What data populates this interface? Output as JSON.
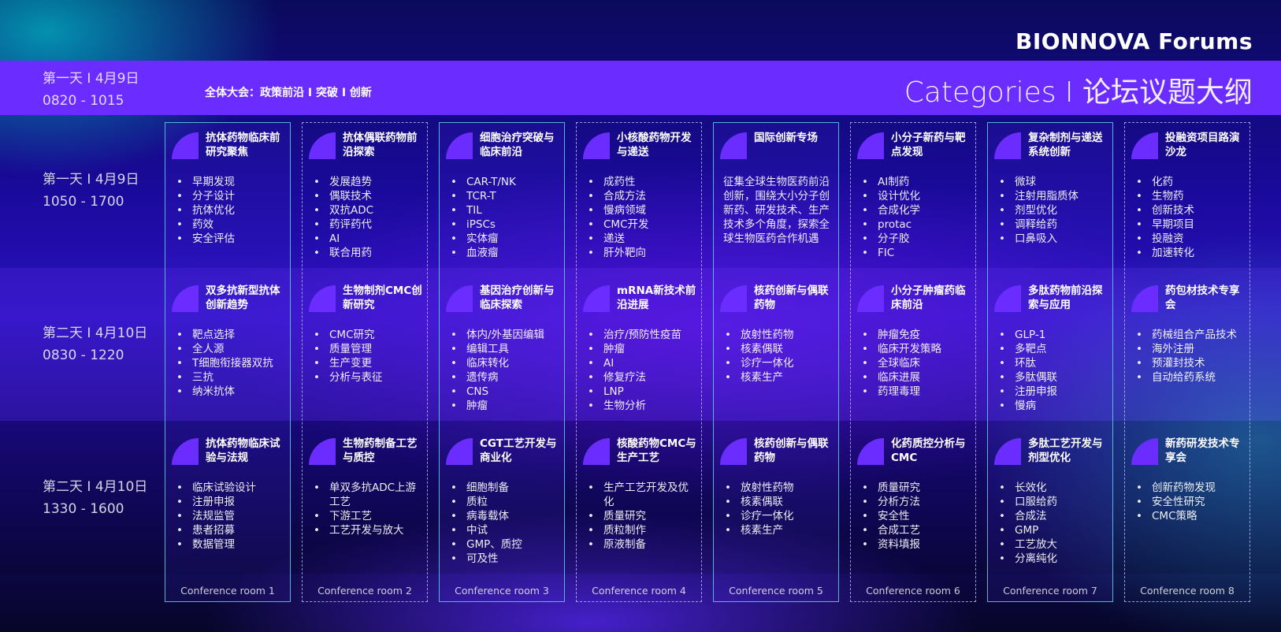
{
  "brand": "BIONNOVA Forums",
  "header": {
    "day_line": "第一天 I 4月9日",
    "time_line": "0820 - 1015",
    "plenary": "全体大会：政策前沿 I 突破 I 创新",
    "categories": "Categories   I   论坛议题大纲"
  },
  "rows": [
    {
      "day": "第一天 I 4月9日",
      "time": "1050 - 1700"
    },
    {
      "day": "第二天 I 4月10日",
      "time": "0830 - 1220"
    },
    {
      "day": "第二天 I 4月10日",
      "time": "1330 - 1600"
    }
  ],
  "columns": [
    {
      "room": "Conference room 1",
      "cells": [
        {
          "title": "抗体药物临床前研究聚焦",
          "items": [
            "早期发现",
            "分子设计",
            "抗体优化",
            "药效",
            "安全评估"
          ]
        },
        {
          "title": "双多抗新型抗体创新趋势",
          "items": [
            "靶点选择",
            "全人源",
            "T细胞衔接器双抗",
            "三抗",
            "纳米抗体"
          ]
        },
        {
          "title": "抗体药物临床试验与法规",
          "items": [
            "临床试验设计",
            "注册申报",
            "法规监管",
            "患者招募",
            "数据管理"
          ]
        }
      ]
    },
    {
      "room": "Conference room 2",
      "cells": [
        {
          "title": "抗体偶联药物前沿探索",
          "items": [
            "发展趋势",
            "偶联技术",
            "双抗ADC",
            "药评药代",
            "AI",
            "联合用药"
          ]
        },
        {
          "title": "生物制剂CMC创新研究",
          "items": [
            "CMC研究",
            "质量管理",
            "生产变更",
            "分析与表征"
          ]
        },
        {
          "title": "生物药制备工艺与质控",
          "items": [
            "单双多抗ADC上游工艺",
            "下游工艺",
            "工艺开发与放大"
          ]
        }
      ]
    },
    {
      "room": "Conference room 3",
      "cells": [
        {
          "title": "细胞治疗突破与临床前沿",
          "items": [
            "CAR-T/NK",
            "TCR-T",
            "TIL",
            "iPSCs",
            "实体瘤",
            "血液瘤"
          ]
        },
        {
          "title": "基因治疗创新与临床探索",
          "items": [
            "体内/外基因编辑",
            "编辑工具",
            "临床转化",
            "遗传病",
            "CNS",
            "肿瘤"
          ]
        },
        {
          "title": "CGT工艺开发与商业化",
          "items": [
            "细胞制备",
            "质粒",
            "病毒载体",
            "中试",
            "GMP、质控",
            "可及性"
          ]
        }
      ]
    },
    {
      "room": "Conference room 4",
      "cells": [
        {
          "title": "小核酸药物开发与递送",
          "items": [
            "成药性",
            "合成方法",
            "慢病领域",
            "CMC开发",
            "递送",
            "肝外靶向"
          ]
        },
        {
          "title": "mRNA新技术前沿进展",
          "items": [
            "治疗/预防性疫苗",
            "肿瘤",
            "AI",
            "修复疗法",
            "LNP",
            "生物分析"
          ]
        },
        {
          "title": "核酸药物CMC与生产工艺",
          "items": [
            "生产工艺开发及优化",
            "质量研究",
            "质粒制作",
            "原液制备"
          ]
        }
      ]
    },
    {
      "room": "Conference room 5",
      "cells": [
        {
          "title": "国际创新专场",
          "paragraph": "征集全球生物医药前沿创新，围绕大小分子创新药、研发技术、生产技术多个角度，探索全球生物医药合作机遇"
        },
        {
          "title": "核药创新与偶联药物",
          "items": [
            "放射性药物",
            "核素偶联",
            "诊疗一体化",
            "核素生产"
          ]
        },
        {
          "title": "核药创新与偶联药物",
          "items": [
            "放射性药物",
            "核素偶联",
            "诊疗一体化",
            "核素生产"
          ]
        }
      ]
    },
    {
      "room": "Conference room 6",
      "cells": [
        {
          "title": "小分子新药与靶点发现",
          "items": [
            "AI制药",
            "设计优化",
            "合成化学",
            "protac",
            "分子胶",
            "FIC"
          ]
        },
        {
          "title": "小分子肿瘤药临床前沿",
          "items": [
            "肿瘤免疫",
            "临床开发策略",
            "全球临床",
            "临床进展",
            "药理毒理"
          ]
        },
        {
          "title": "化药质控分析与CMC",
          "items": [
            "质量研究",
            "分析方法",
            "安全性",
            "合成工艺",
            "资料填报"
          ]
        }
      ]
    },
    {
      "room": "Conference room 7",
      "cells": [
        {
          "title": "复杂制剂与递送系统创新",
          "items": [
            "微球",
            "注射用脂质体",
            "剂型优化",
            "调释给药",
            "口鼻吸入"
          ]
        },
        {
          "title": "多肽药物前沿探索与应用",
          "items": [
            "GLP-1",
            "多靶点",
            "环肽",
            "多肽偶联",
            "注册申报",
            "慢病"
          ]
        },
        {
          "title": "多肽工艺开发与剂型优化",
          "items": [
            "长效化",
            "口服给药",
            "合成法",
            "GMP",
            "工艺放大",
            "分离纯化"
          ]
        }
      ]
    },
    {
      "room": "Conference room 8",
      "cells": [
        {
          "title": "投融资项目路演沙龙",
          "items": [
            "化药",
            "生物药",
            "创新技术",
            "早期项目",
            "投融资",
            "加速转化"
          ]
        },
        {
          "title": "药包材技术专享会",
          "items": [
            "药械组合产品技术",
            "海外注册",
            "预灌封技术",
            "自动给药系统"
          ]
        },
        {
          "title": "新药研发技术专享会",
          "items": [
            "创新药物发现",
            "安全性研究",
            "CMC策略"
          ]
        }
      ]
    }
  ],
  "colors": {
    "accent": "#6b2cff",
    "solid_border": "#5ad2e6",
    "dashed_border": "#c8c8ff"
  }
}
